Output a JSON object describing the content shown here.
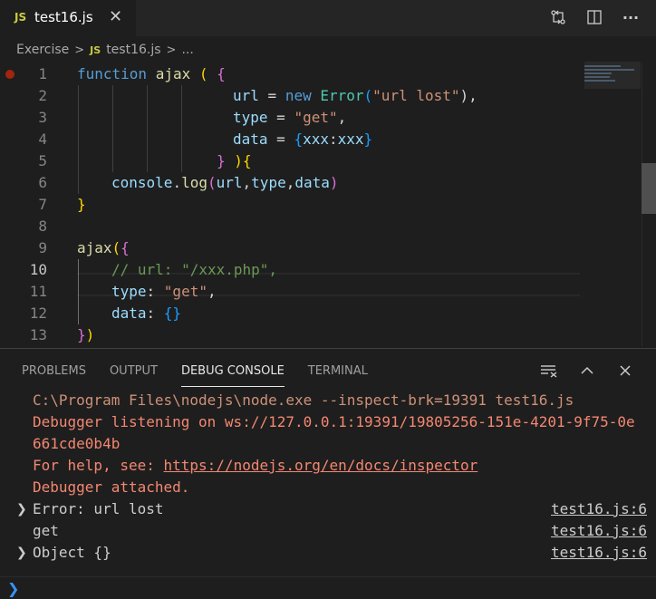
{
  "tab": {
    "icon_text": "JS",
    "name": "test16.js",
    "close_glyph": "✕"
  },
  "tab_actions": {
    "open_changes_icon": "git-compare-icon",
    "split_editor_icon": "split-editor-icon",
    "more_icon": "more-actions-icon",
    "more_glyph": "···"
  },
  "breadcrumbs": {
    "folder": "Exercise",
    "file_icon_text": "JS",
    "file": "test16.js",
    "tail": "...",
    "sep": ">"
  },
  "editor": {
    "line_numbers": [
      "1",
      "2",
      "3",
      "4",
      "5",
      "6",
      "7",
      "8",
      "9",
      "10",
      "11",
      "12",
      "13"
    ],
    "breakpoint_line": 1,
    "lines": [
      [
        {
          "t": "function",
          "c": "kw"
        },
        {
          "t": " ",
          "c": "pl"
        },
        {
          "t": "ajax",
          "c": "fn"
        },
        {
          "t": " ",
          "c": "pl"
        },
        {
          "t": "(",
          "c": "b1"
        },
        {
          "t": " ",
          "c": "pl"
        },
        {
          "t": "{",
          "c": "b2"
        }
      ],
      [
        {
          "t": "url",
          "c": "vr"
        },
        {
          "t": " = ",
          "c": "pl"
        },
        {
          "t": "new",
          "c": "kw"
        },
        {
          "t": " ",
          "c": "pl"
        },
        {
          "t": "Error",
          "c": "cl"
        },
        {
          "t": "(",
          "c": "b3"
        },
        {
          "t": "\"url lost\"",
          "c": "st"
        },
        {
          "t": "),",
          "c": "pl"
        }
      ],
      [
        {
          "t": "type",
          "c": "vr"
        },
        {
          "t": " = ",
          "c": "pl"
        },
        {
          "t": "\"get\"",
          "c": "st"
        },
        {
          "t": ",",
          "c": "pl"
        }
      ],
      [
        {
          "t": "data",
          "c": "vr"
        },
        {
          "t": " = ",
          "c": "pl"
        },
        {
          "t": "{",
          "c": "b3"
        },
        {
          "t": "xxx",
          "c": "vr"
        },
        {
          "t": ":",
          "c": "pl"
        },
        {
          "t": "xxx",
          "c": "vr"
        },
        {
          "t": "}",
          "c": "b3"
        }
      ],
      [
        {
          "t": "}",
          "c": "b2"
        },
        {
          "t": " ",
          "c": "pl"
        },
        {
          "t": ")",
          "c": "b1"
        },
        {
          "t": "{",
          "c": "b1"
        }
      ],
      [
        {
          "t": "console",
          "c": "vr"
        },
        {
          "t": ".",
          "c": "pl"
        },
        {
          "t": "log",
          "c": "fn"
        },
        {
          "t": "(",
          "c": "b2"
        },
        {
          "t": "url",
          "c": "vr"
        },
        {
          "t": ",",
          "c": "pl"
        },
        {
          "t": "type",
          "c": "vr"
        },
        {
          "t": ",",
          "c": "pl"
        },
        {
          "t": "data",
          "c": "vr"
        },
        {
          "t": ")",
          "c": "b2"
        }
      ],
      [
        {
          "t": "}",
          "c": "b1"
        }
      ],
      [],
      [
        {
          "t": "ajax",
          "c": "fn"
        },
        {
          "t": "(",
          "c": "b1"
        },
        {
          "t": "{",
          "c": "b2"
        }
      ],
      [
        {
          "t": "// url: \"/xxx.php\",",
          "c": "cm"
        }
      ],
      [
        {
          "t": "type",
          "c": "vr"
        },
        {
          "t": ": ",
          "c": "pl"
        },
        {
          "t": "\"get\"",
          "c": "st"
        },
        {
          "t": ",",
          "c": "pl"
        }
      ],
      [
        {
          "t": "data",
          "c": "vr"
        },
        {
          "t": ": ",
          "c": "pl"
        },
        {
          "t": "{}",
          "c": "b3"
        }
      ],
      [
        {
          "t": "}",
          "c": "b2"
        },
        {
          "t": ")",
          "c": "b1"
        }
      ]
    ]
  },
  "panel": {
    "tabs": [
      "PROBLEMS",
      "OUTPUT",
      "DEBUG CONSOLE",
      "TERMINAL"
    ],
    "active_tab": "DEBUG CONSOLE",
    "actions": {
      "clear_icon": "clear-console-icon",
      "maximize_icon": "chevron-up-icon",
      "close_icon": "close-icon"
    },
    "output": {
      "cmd": "C:\\Program Files\\nodejs\\node.exe --inspect-brk=19391 test16.js",
      "listen1": "Debugger listening on ws://127.0.0.1:19391/19805256-151e-4201-9f75-0e",
      "listen2": "661cde0b4b",
      "help_prefix": "For help, see: ",
      "help_link": "https://nodejs.org/en/docs/inspector",
      "attached": "Debugger attached.",
      "row1": "Error: url lost",
      "row2": "get",
      "row3": "Object {}",
      "src": "test16.js:6"
    },
    "prompt_glyph": "❯"
  }
}
